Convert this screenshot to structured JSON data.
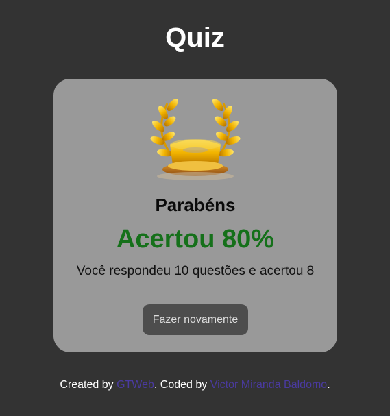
{
  "page": {
    "title": "Quiz"
  },
  "result": {
    "icon": "laurel-trophy-icon",
    "congrats": "Parabéns",
    "score": "Acertou 80%",
    "summary": "Você respondeu 10 questões e acertou 8",
    "retry_label": "Fazer novamente"
  },
  "footer": {
    "created_prefix": "Created by ",
    "created_link": "GTWeb",
    "coded_prefix": ". Coded by ",
    "coded_link": "Victor Miranda Baldomo",
    "suffix": "."
  },
  "colors": {
    "background": "#333333",
    "card": "#999999",
    "score": "#15701a",
    "button": "#4d4d4d",
    "link": "#4a3aa0"
  }
}
